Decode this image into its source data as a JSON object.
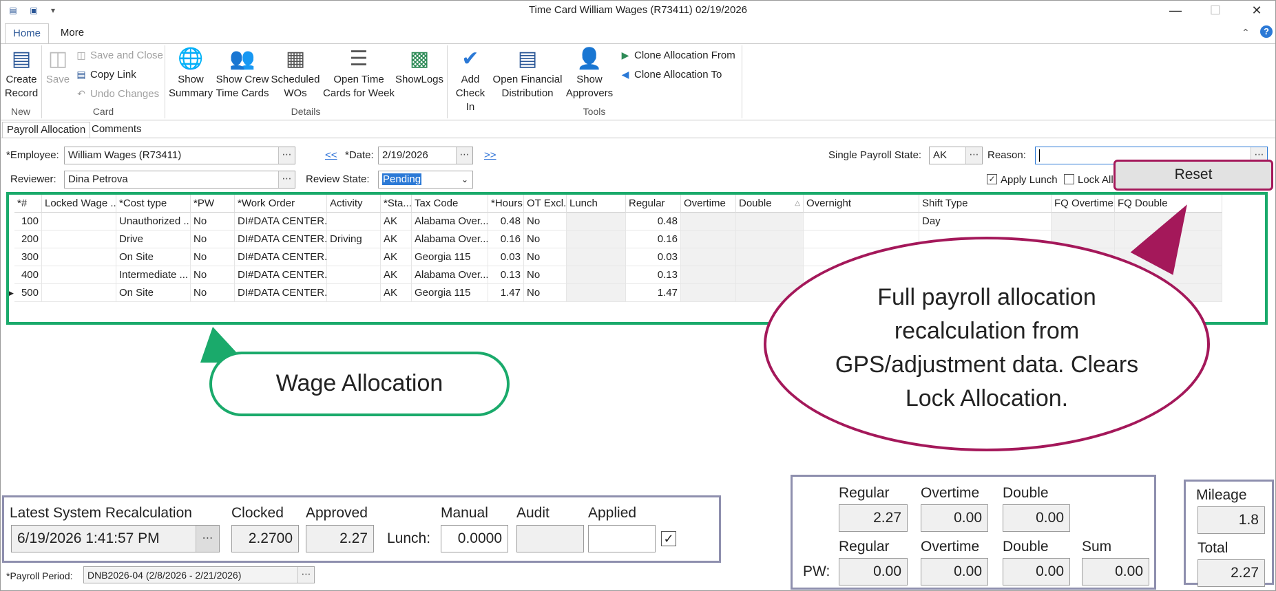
{
  "window": {
    "title": "Time Card William Wages (R73411) 02/19/2026"
  },
  "tabs": [
    "Home",
    "More"
  ],
  "ribbon": {
    "new": {
      "group": "New",
      "create": "Create Record"
    },
    "card": {
      "group": "Card",
      "save": "Save",
      "save_close": "Save and Close",
      "copy_link": "Copy Link",
      "undo": "Undo Changes"
    },
    "details": {
      "group": "Details",
      "show_summary": "Show Summary",
      "show_crew": "Show Crew Time Cards",
      "scheduled": "Scheduled WOs",
      "open_time": "Open Time Cards for Week",
      "showlogs": "ShowLogs"
    },
    "tools": {
      "group": "Tools",
      "add_checkin": "Add Check In",
      "open_fin": "Open Financial Distribution",
      "show_approvers": "Show Approvers",
      "clone_from": "Clone Allocation From",
      "clone_to": "Clone Allocation To"
    }
  },
  "subtabs": [
    "Payroll Allocation",
    "Comments"
  ],
  "form": {
    "employee_label": "*Employee:",
    "employee": "William Wages (R73411)",
    "prev": "<<",
    "next": ">>",
    "date_label": "*Date:",
    "date": "2/19/2026",
    "single_state_label": "Single Payroll State:",
    "single_state": "AK",
    "reason_label": "Reason:",
    "reason": "",
    "reviewer_label": "Reviewer:",
    "reviewer": "Dina Petrova",
    "review_state_label": "Review State:",
    "review_state": "Pending",
    "apply_lunch": "Apply Lunch",
    "lock_all": "Lock All",
    "reset": "Reset"
  },
  "grid": {
    "headers": [
      "*#",
      "Locked Wage ...",
      "*Cost type",
      "*PW",
      "*Work Order",
      "Activity",
      "*Sta...",
      "Tax Code",
      "*Hours",
      "OT Excl...",
      "Lunch",
      "Regular",
      "Overtime",
      "Double",
      "Overnight",
      "Shift Type",
      "FQ Overtime",
      "FQ Double"
    ],
    "rows": [
      {
        "num": "100",
        "cost": "Unauthorized ...",
        "pw": "No",
        "wo": "DI#DATA CENTER...",
        "activity": "",
        "state": "AK",
        "tax": "Alabama Over...",
        "hours": "0.48",
        "ot": "No",
        "regular": "0.48",
        "shift": "Day"
      },
      {
        "num": "200",
        "cost": "Drive",
        "pw": "No",
        "wo": "DI#DATA CENTER...",
        "activity": "Driving",
        "state": "AK",
        "tax": "Alabama Over...",
        "hours": "0.16",
        "ot": "No",
        "regular": "0.16",
        "shift": ""
      },
      {
        "num": "300",
        "cost": "On Site",
        "pw": "No",
        "wo": "DI#DATA CENTER...",
        "activity": "",
        "state": "AK",
        "tax": "Georgia 115",
        "hours": "0.03",
        "ot": "No",
        "regular": "0.03",
        "shift": ""
      },
      {
        "num": "400",
        "cost": "Intermediate ...",
        "pw": "No",
        "wo": "DI#DATA CENTER...",
        "activity": "",
        "state": "AK",
        "tax": "Alabama Over...",
        "hours": "0.13",
        "ot": "No",
        "regular": "0.13",
        "shift": ""
      },
      {
        "num": "500",
        "cost": "On Site",
        "pw": "No",
        "wo": "DI#DATA CENTER...",
        "activity": "",
        "state": "AK",
        "tax": "Georgia 115",
        "hours": "1.47",
        "ot": "No",
        "regular": "1.47",
        "shift": ""
      }
    ]
  },
  "callouts": {
    "wage": "Wage Allocation",
    "reset_line1": "Full payroll allocation",
    "reset_line2": "recalculation from",
    "reset_line3": "GPS/adjustment data. Clears",
    "reset_line4": "Lock Allocation."
  },
  "footer": {
    "latest_label": "Latest System Recalculation",
    "latest": "6/19/2026 1:41:57 PM",
    "clocked_label": "Clocked",
    "clocked": "2.2700",
    "approved_label": "Approved",
    "approved": "2.27",
    "lunch_label": "Lunch:",
    "manual_label": "Manual",
    "manual": "0.0000",
    "audit_label": "Audit",
    "audit": "",
    "applied_label": "Applied",
    "applied": "",
    "period_label": "*Payroll Period:",
    "period": "DNB2026-04 (2/8/2026 - 2/21/2026)"
  },
  "totals": {
    "regular_label": "Regular",
    "overtime_label": "Overtime",
    "double_label": "Double",
    "sum_label": "Sum",
    "regular": "2.27",
    "overtime": "0.00",
    "double": "0.00",
    "pw_label": "PW:",
    "pw_regular": "0.00",
    "pw_overtime": "0.00",
    "pw_double": "0.00",
    "pw_sum": "0.00"
  },
  "mileage": {
    "mileage_label": "Mileage",
    "mileage": "1.8",
    "total_label": "Total",
    "total": "2.27"
  },
  "colors": {
    "accent": "#2b5797",
    "callout_green": "#1aaa6b",
    "callout_purple": "#a4185a",
    "box_border": "#8e8fae"
  }
}
